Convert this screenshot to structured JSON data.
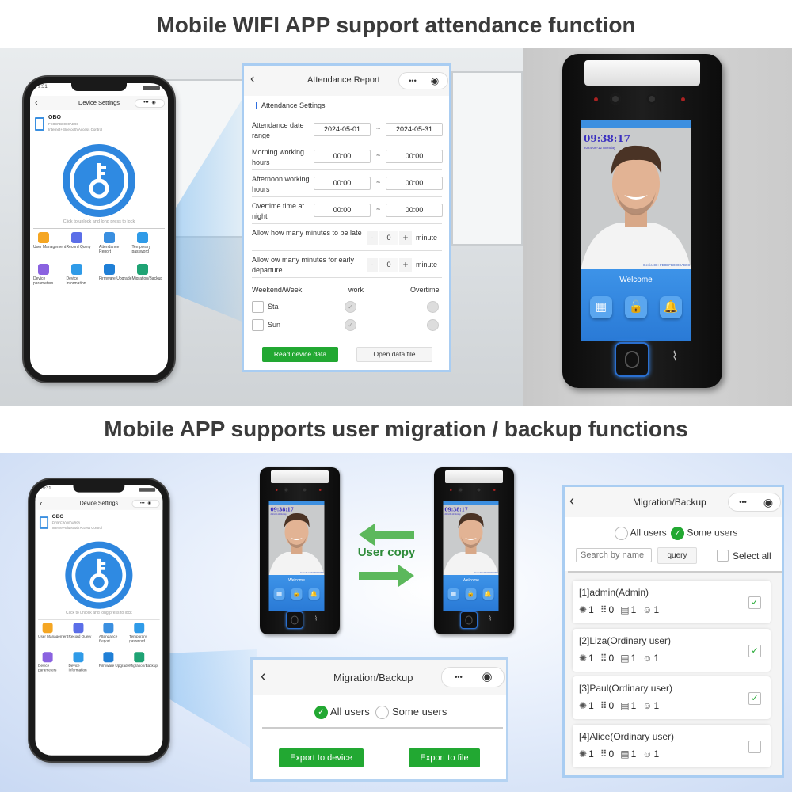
{
  "headings": {
    "top": "Mobile WIFI APP support attendance function",
    "bottom": "Mobile APP supports user migration / backup functions"
  },
  "colors": {
    "accent_green": "#22a832",
    "accent_blue": "#2e86de",
    "panel_border": "#a9cdf2"
  },
  "phone": {
    "time": "9:31",
    "title": "Device Settings",
    "caps_more": "•••",
    "caps_close": "◉",
    "back": "‹",
    "device_name": "OBO",
    "device_id": "FE0EFB0000AB98",
    "device_type": "Internet+Bluetooth Access Control",
    "unlock_hint": "Click to unlock and long press to lock",
    "menu": [
      {
        "label": "User Management",
        "icon": "user-gear-icon",
        "color": "#f5a623"
      },
      {
        "label": "Record Query",
        "icon": "record-icon",
        "color": "#5b6ee8"
      },
      {
        "label": "Attendance Report",
        "icon": "calendar-gear-icon",
        "color": "#3a8fe0"
      },
      {
        "label": "Temporary password",
        "icon": "lock-icon",
        "color": "#2f9be8"
      },
      {
        "label": "Device parameters",
        "icon": "gear-icon",
        "color": "#8a62e0"
      },
      {
        "label": "Device Information",
        "icon": "id-card-icon",
        "color": "#2f9be8"
      },
      {
        "label": "Firmware Upgrade",
        "icon": "upload-icon",
        "color": "#1f7fd6"
      },
      {
        "label": "Migration/Backup",
        "icon": "share-icon",
        "color": "#1fa374"
      }
    ]
  },
  "attendance": {
    "back": "‹",
    "title": "Attendance Report",
    "caps_more": "•••",
    "caps_close": "◉",
    "section": "Attendance Settings",
    "rows": [
      {
        "label": "Attendance date range",
        "from": "2024-05-01",
        "to": "2024-05-31"
      },
      {
        "label": "Morning working hours",
        "from": "00:00",
        "to": "00:00"
      },
      {
        "label": "Afternoon working hours",
        "from": "00:00",
        "to": "00:00"
      },
      {
        "label": "Overtime time at night",
        "from": "00:00",
        "to": "00:00"
      }
    ],
    "tilde": "~",
    "steppers": [
      {
        "label": "Allow how many minutes to be late",
        "value": "0",
        "unit": "minute"
      },
      {
        "label": "Allow ow many minutes for early departure",
        "value": "0",
        "unit": "minute"
      }
    ],
    "minus": "-",
    "plus": "+",
    "week_header": {
      "col1": "Weekend/Week",
      "col2": "work",
      "col3": "Overtime"
    },
    "days": [
      {
        "label": "Sta",
        "checked": false
      },
      {
        "label": "Sun",
        "checked": false
      }
    ],
    "read_btn": "Read device data",
    "open_btn": "Open data file"
  },
  "device": {
    "time": "09:38:17",
    "date": "2024-06-12 Monday",
    "device_id": "DeviceID: FE0EFB0000AB98",
    "welcome": "Welcome"
  },
  "user_copy": "User copy",
  "migration_small": {
    "back": "‹",
    "title": "Migration/Backup",
    "caps_more": "•••",
    "caps_close": "◉",
    "all_users": "All users",
    "some_users": "Some users",
    "selected": "all",
    "export_device": "Export to device",
    "export_file": "Export to file"
  },
  "migration": {
    "back": "‹",
    "title": "Migration/Backup",
    "caps_more": "•••",
    "caps_close": "◉",
    "all_users": "All users",
    "some_users": "Some users",
    "selected": "some",
    "search_placeholder": "Search by name",
    "query": "query",
    "select_all": "Select all",
    "users": [
      {
        "name": "[1]admin(Admin)",
        "fingerprint": "1",
        "password": "0",
        "card": "1",
        "face": "1",
        "checked": true
      },
      {
        "name": "[2]Liza(Ordinary user)",
        "fingerprint": "1",
        "password": "0",
        "card": "1",
        "face": "1",
        "checked": true
      },
      {
        "name": "[3]Paul(Ordinary user)",
        "fingerprint": "1",
        "password": "0",
        "card": "1",
        "face": "1",
        "checked": true
      },
      {
        "name": "[4]Alice(Ordinary user)",
        "fingerprint": "1",
        "password": "0",
        "card": "1",
        "face": "1",
        "checked": false
      }
    ]
  }
}
